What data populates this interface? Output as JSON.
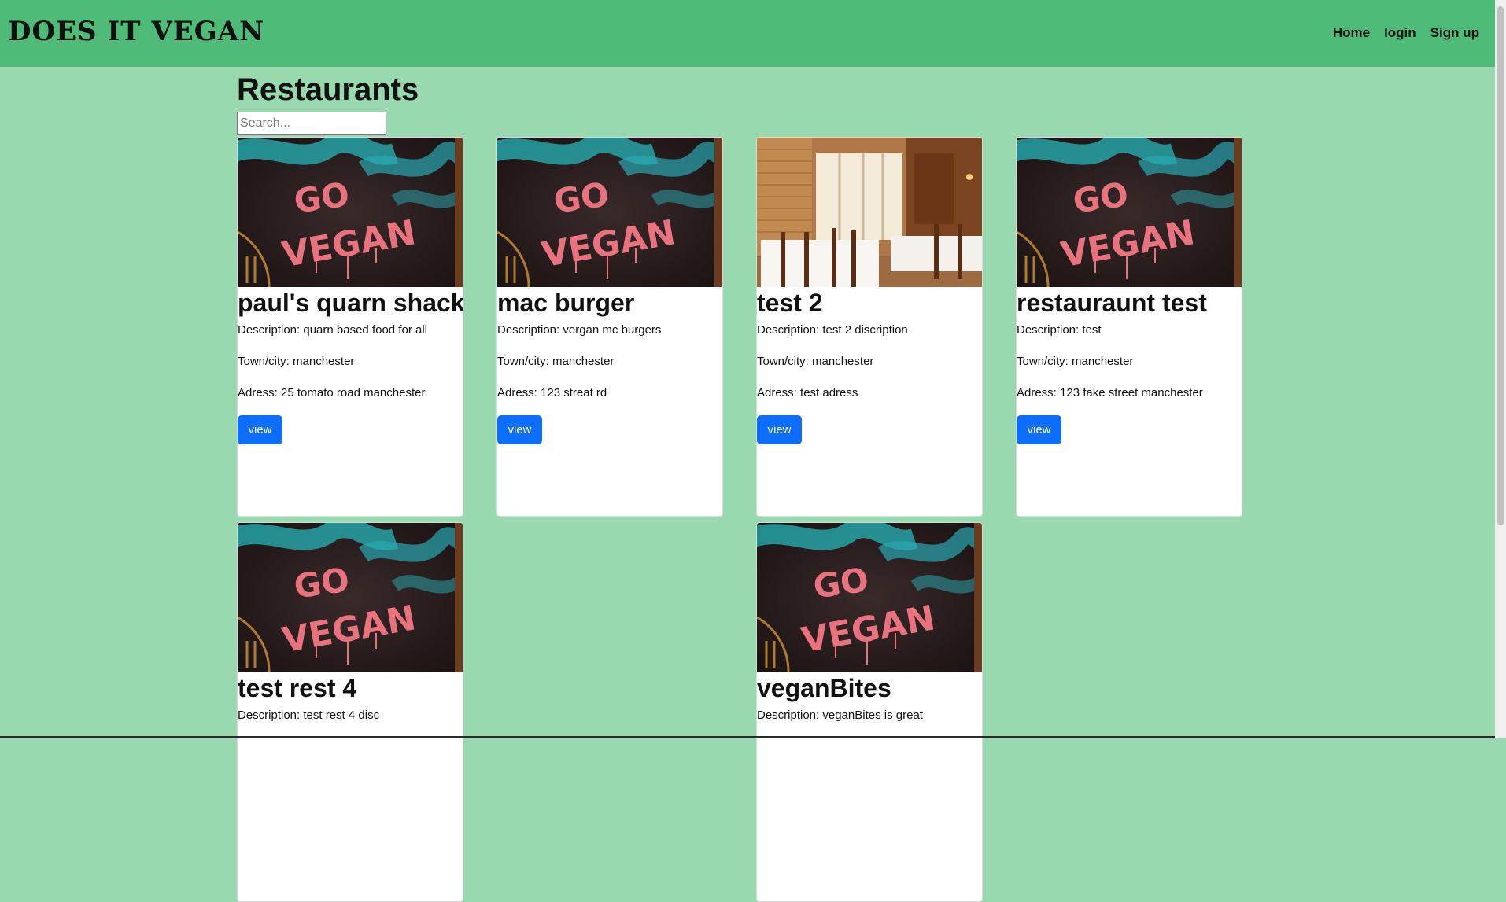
{
  "nav": {
    "brand": "DOES IT VEGAN",
    "links": [
      "Home",
      "login",
      "Sign up"
    ]
  },
  "main": {
    "title": "Restaurants",
    "search_placeholder": "Search..."
  },
  "labels": {
    "description": "Description: ",
    "town": "Town/city: ",
    "address": "Adress: ",
    "view": "view"
  },
  "restaurants": [
    {
      "name": "paul's quarn shack",
      "description": "quarn based food for all",
      "town": "manchester",
      "address": "25 tomato road manchester",
      "image": "go-vegan-graffiti"
    },
    {
      "name": "mac burger",
      "description": "vergan mc burgers",
      "town": "manchester",
      "address": "123 streat rd",
      "image": "go-vegan-graffiti"
    },
    {
      "name": "test 2",
      "description": "test 2 discription",
      "town": "manchester",
      "address": "test adress",
      "image": "restaurant-interior"
    },
    {
      "name": "restauraunt test",
      "description": "test",
      "town": "manchester",
      "address": "123 fake street manchester",
      "image": "go-vegan-graffiti"
    },
    {
      "name": "test rest 4",
      "description": "test rest 4 disc",
      "town": "",
      "address": "",
      "image": "go-vegan-graffiti"
    },
    null,
    {
      "name": "veganBites",
      "description": "veganBites is great",
      "town": "",
      "address": "",
      "image": "go-vegan-graffiti"
    }
  ],
  "colors": {
    "page_bg": "#98d9b0",
    "navbar": "#4ebc78",
    "button": "#0d6efd"
  }
}
